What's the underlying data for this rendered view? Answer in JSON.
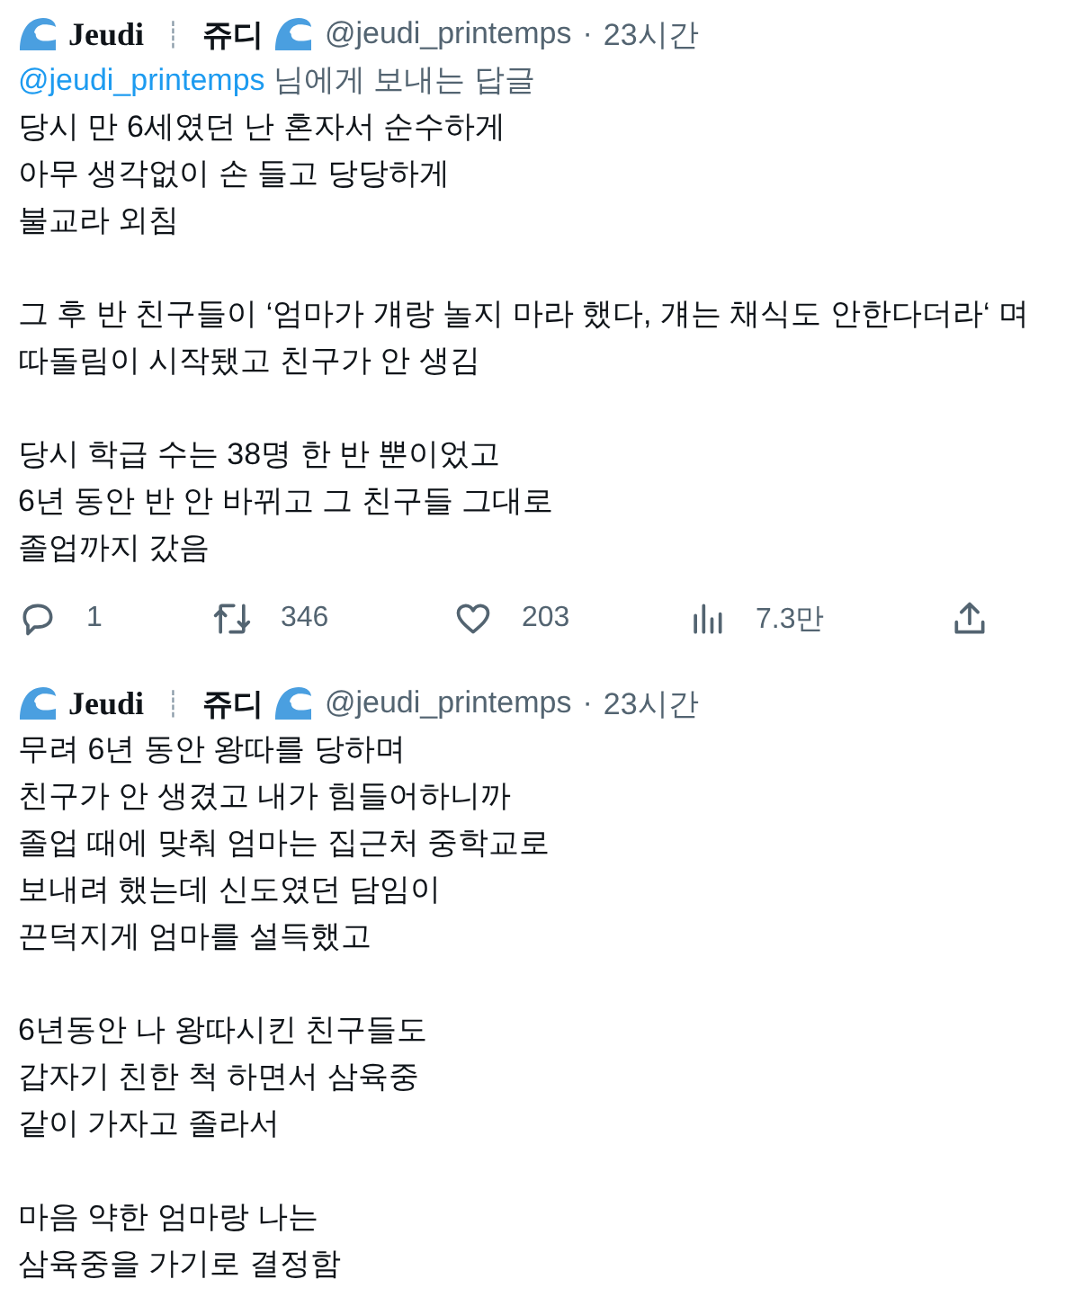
{
  "tweets": [
    {
      "author": {
        "name_latin": "Jeudi",
        "separator": "┊",
        "name_korean": "쥬디",
        "handle": "@jeudi_printemps",
        "dot": "·",
        "time": "23시간"
      },
      "reply_to": {
        "handle": "@jeudi_printemps",
        "suffix": " 님에게 보내는 답글"
      },
      "paragraphs": [
        "당시 만 6세였던 난 혼자서 순수하게\n아무 생각없이 손 들고 당당하게\n불교라 외침",
        "그 후 반 친구들이 ‘엄마가 걔랑 놀지 마라 했다, 걔는 채식도 안한다더라‘ 며\n따돌림이 시작됐고 친구가 안 생김",
        "당시 학급 수는 38명 한 반 뿐이었고\n6년 동안 반 안 바뀌고 그 친구들 그대로\n졸업까지 갔음"
      ],
      "actions": {
        "replies": "1",
        "retweets": "346",
        "likes": "203",
        "views": "7.3만"
      }
    },
    {
      "author": {
        "name_latin": "Jeudi",
        "separator": "┊",
        "name_korean": "쥬디",
        "handle": "@jeudi_printemps",
        "dot": "·",
        "time": "23시간"
      },
      "paragraphs": [
        "무려 6년 동안 왕따를 당하며\n친구가 안 생겼고 내가 힘들어하니까\n졸업 때에 맞춰 엄마는 집근처 중학교로\n보내려 했는데 신도였던 담임이\n끈덕지게 엄마를 설득했고",
        "6년동안 나 왕따시킨 친구들도\n갑자기 친한 척 하면서 삼육중\n같이 가자고 졸라서",
        "마음 약한 엄마랑 나는\n삼육중을 가기로 결정함"
      ]
    }
  ]
}
